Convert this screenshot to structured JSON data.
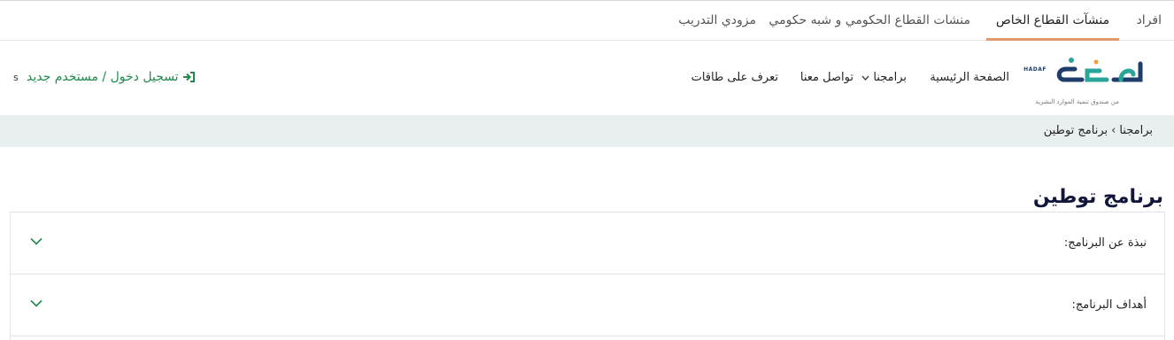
{
  "top_tabs": {
    "individuals": "افراد",
    "private_sector": "منشآت القطاع الخاص",
    "government_sector": "منشات القطاع الحكومي و شبه حكومي",
    "training_providers": "مزودي التدريب"
  },
  "header": {
    "logo_caption": "من صندوق تنمية الموارد البشرية",
    "logo_en": "HADAF",
    "nav": {
      "home": "الصفحة الرئيسية",
      "programs": "برامجنا",
      "contact": "تواصل معنا",
      "taqat": "تعرف على طاقات"
    },
    "login_label": "تسجيل دخول / مستخدم جديد",
    "language_toggle": "s"
  },
  "breadcrumb": {
    "parent": "برامجنا",
    "separator": "›",
    "current": "برنامج توطين"
  },
  "page": {
    "title": "برنامج توطين"
  },
  "accordion": [
    {
      "title": "نبذة عن البرنامج:"
    },
    {
      "title": "أهداف البرنامج:"
    }
  ],
  "colors": {
    "brand_teal": "#2aa59a",
    "brand_navy": "#1e3d6b",
    "accent_green": "#1f8a4c",
    "active_tab_underline": "#e29a6f",
    "breadcrumb_bg": "#e9eef1"
  },
  "icons": {
    "login": "sign-in-icon",
    "nav_dropdown": "chevron-down-icon",
    "accordion_toggle": "chevron-down-icon"
  }
}
